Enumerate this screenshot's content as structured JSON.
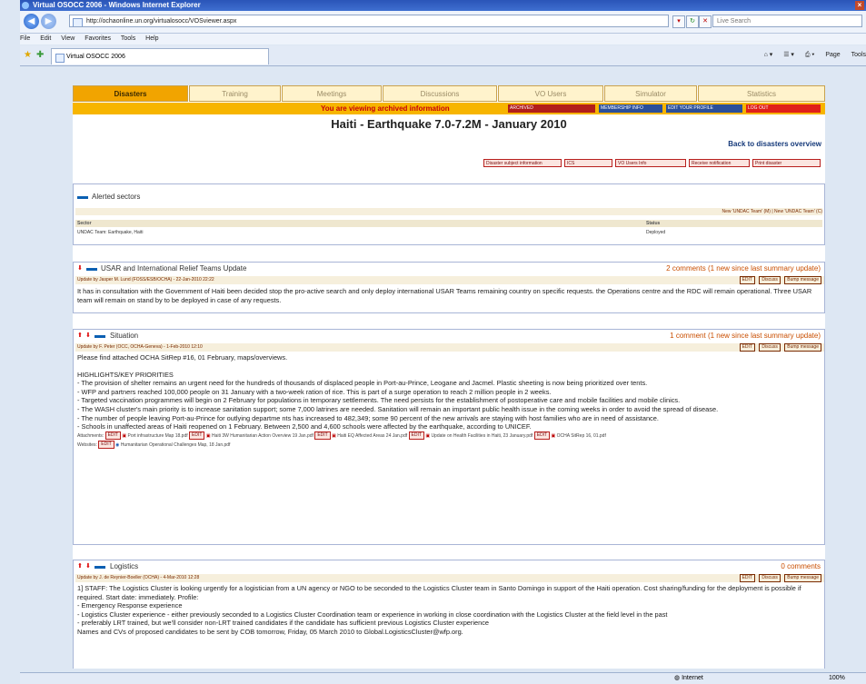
{
  "browser": {
    "title": "Virtual OSOCC 2006 - Windows Internet Explorer",
    "address": "http://ochaonline.un.org/virtualosocc/VOSviewer.aspx",
    "search_placeholder": "Live Search",
    "menu": [
      "File",
      "Edit",
      "View",
      "Favorites",
      "Tools",
      "Help"
    ],
    "tab_title": "Virtual OSOCC 2006",
    "cmd": [
      "Page",
      "Tools"
    ]
  },
  "nav_tabs": [
    "Disasters",
    "Training",
    "Meetings",
    "Discussions",
    "VO Users",
    "Simulator",
    "Statistics"
  ],
  "archive": {
    "message": "You are viewing archived information",
    "buttons": [
      "ARCHIVED",
      "MEMBERSHIP INFO",
      "EDIT YOUR PROFILE",
      "LOG OUT"
    ]
  },
  "page_title": "Haiti - Earthquake 7.0-7.2M - January 2010",
  "back_link": "Back to disasters overview",
  "action_buttons": [
    "Disaster subject information",
    "ICS",
    "VO Users Info",
    "Receive notification",
    "Print disaster"
  ],
  "alerted": {
    "heading": "Alerted sectors",
    "links": "New 'UNDAC Team' (M) | New 'UNDAC Team' (C)",
    "col_sector": "Sector",
    "col_status": "Status",
    "row_sector": "UNDAC Team: Earthquake, Haiti",
    "row_status": "Deployed"
  },
  "sections": [
    {
      "title": "USAR and International Relief Teams Update",
      "comments": "2 comments (1 new since last summary update)",
      "update_by": "Update by Jasper M. Lund (FOSS/ESB/OCHA) - 22-Jan-2010 22:22",
      "buttons": [
        "EDIT",
        "Discuss",
        "Bump message"
      ],
      "body": "It has in consultation with the Government of Haiti been decided stop the pro-active search and only deploy international USAR Teams remaining country on specific requests. the Operations centre and the RDC will remain operational. Three USAR team will remain on stand by to be deployed in case of any requests."
    },
    {
      "title": "Situation",
      "comments": "1 comment (1 new since last summary update)",
      "update_by": "Update by F. Peter (OCC, OCHA-Geneva) - 1-Feb-2010 12:10",
      "buttons": [
        "EDIT",
        "Discuss",
        "Bump message"
      ],
      "intro": "Please find attached OCHA SitRep #16, 01 February, maps/overviews.",
      "heading": "HIGHLIGHTS/KEY PRIORITIES",
      "bullets": [
        "- The provision of shelter remains an urgent need for the hundreds of thousands of displaced people in Port-au-Prince, Leogane and Jacmel. Plastic sheeting is now being prioritized over tents.",
        "- WFP and partners reached 100,000 people on 31 January with a two-week ration of rice. This is part of a surge operation to reach 2 million people in 2 weeks.",
        "- Targeted vaccination programmes will begin on 2 February for populations in temporary settlements. The need persists for the establishment of postoperative care and mobile facilities and mobile clinics.",
        "- The WASH cluster's main priority is to increase sanitation support; some 7,000 latrines are needed. Sanitation will remain an important public health issue in the coming weeks in order to avoid the spread of disease.",
        "- The number of people leaving Port-au-Prince for outlying departme nts has increased to 482,349; some 90 percent of the new arrivals are staying with host families who are in need of assistance.",
        "- Schools in unaffected areas of Haiti reopened on 1 February. Between 2,500 and 4,600 schools were affected by the earthquake, according to UNICEF."
      ],
      "attachments_label": "Attachments:",
      "attachments": [
        "Port infrastructure Map 18.pdf",
        "Haiti 3W Humanitarian Action Overview 19 Jan.pdf",
        "Haiti EQ Affected Areas 24 Jan.pdf",
        "Update on Health Facilities in Haiti, 23 January.pdf",
        "OCHA SitRep 16, 01.pdf"
      ],
      "websites_label": "Websites:",
      "websites": [
        "Humanitarian Operational Challenges Map, 18 Jan.pdf"
      ]
    },
    {
      "title": "Logistics",
      "comments": "0 comments",
      "update_by": "Update by J. de Reynier-Boeller (OCHA) - 4-Mar-2010 12:28",
      "buttons": [
        "EDIT",
        "Discuss",
        "Bump message"
      ],
      "lines": [
        "1] STAFF: The Logistics Cluster is looking urgently for a logistician from a UN agency or NGO to be seconded to the Logistics Cluster team in Santo Domingo in support of the Haiti operation. Cost sharing/funding for the deployment is possible if required. Start date: immediately. Profile:",
        "- Emergency Response experience",
        "- Logistics Cluster experience - either previously seconded to a Logistics Cluster Coordination team or experience in working in close coordination with the Logistics Cluster at the field level in the past",
        "- preferably LRT trained, but we'll consider non-LRT trained candidates if the candidate has sufficient previous Logistics Cluster experience",
        "Names and CVs of proposed candidates to be sent by COB tomorrow, Friday, 05 March 2010 to Global.LogisticsCluster@wfp.org."
      ]
    }
  ],
  "status": {
    "zone": "Internet",
    "zoom": "100%"
  },
  "colors": {
    "accent": "#f1a400",
    "alert": "#c6000b",
    "link": "#163a7a"
  }
}
